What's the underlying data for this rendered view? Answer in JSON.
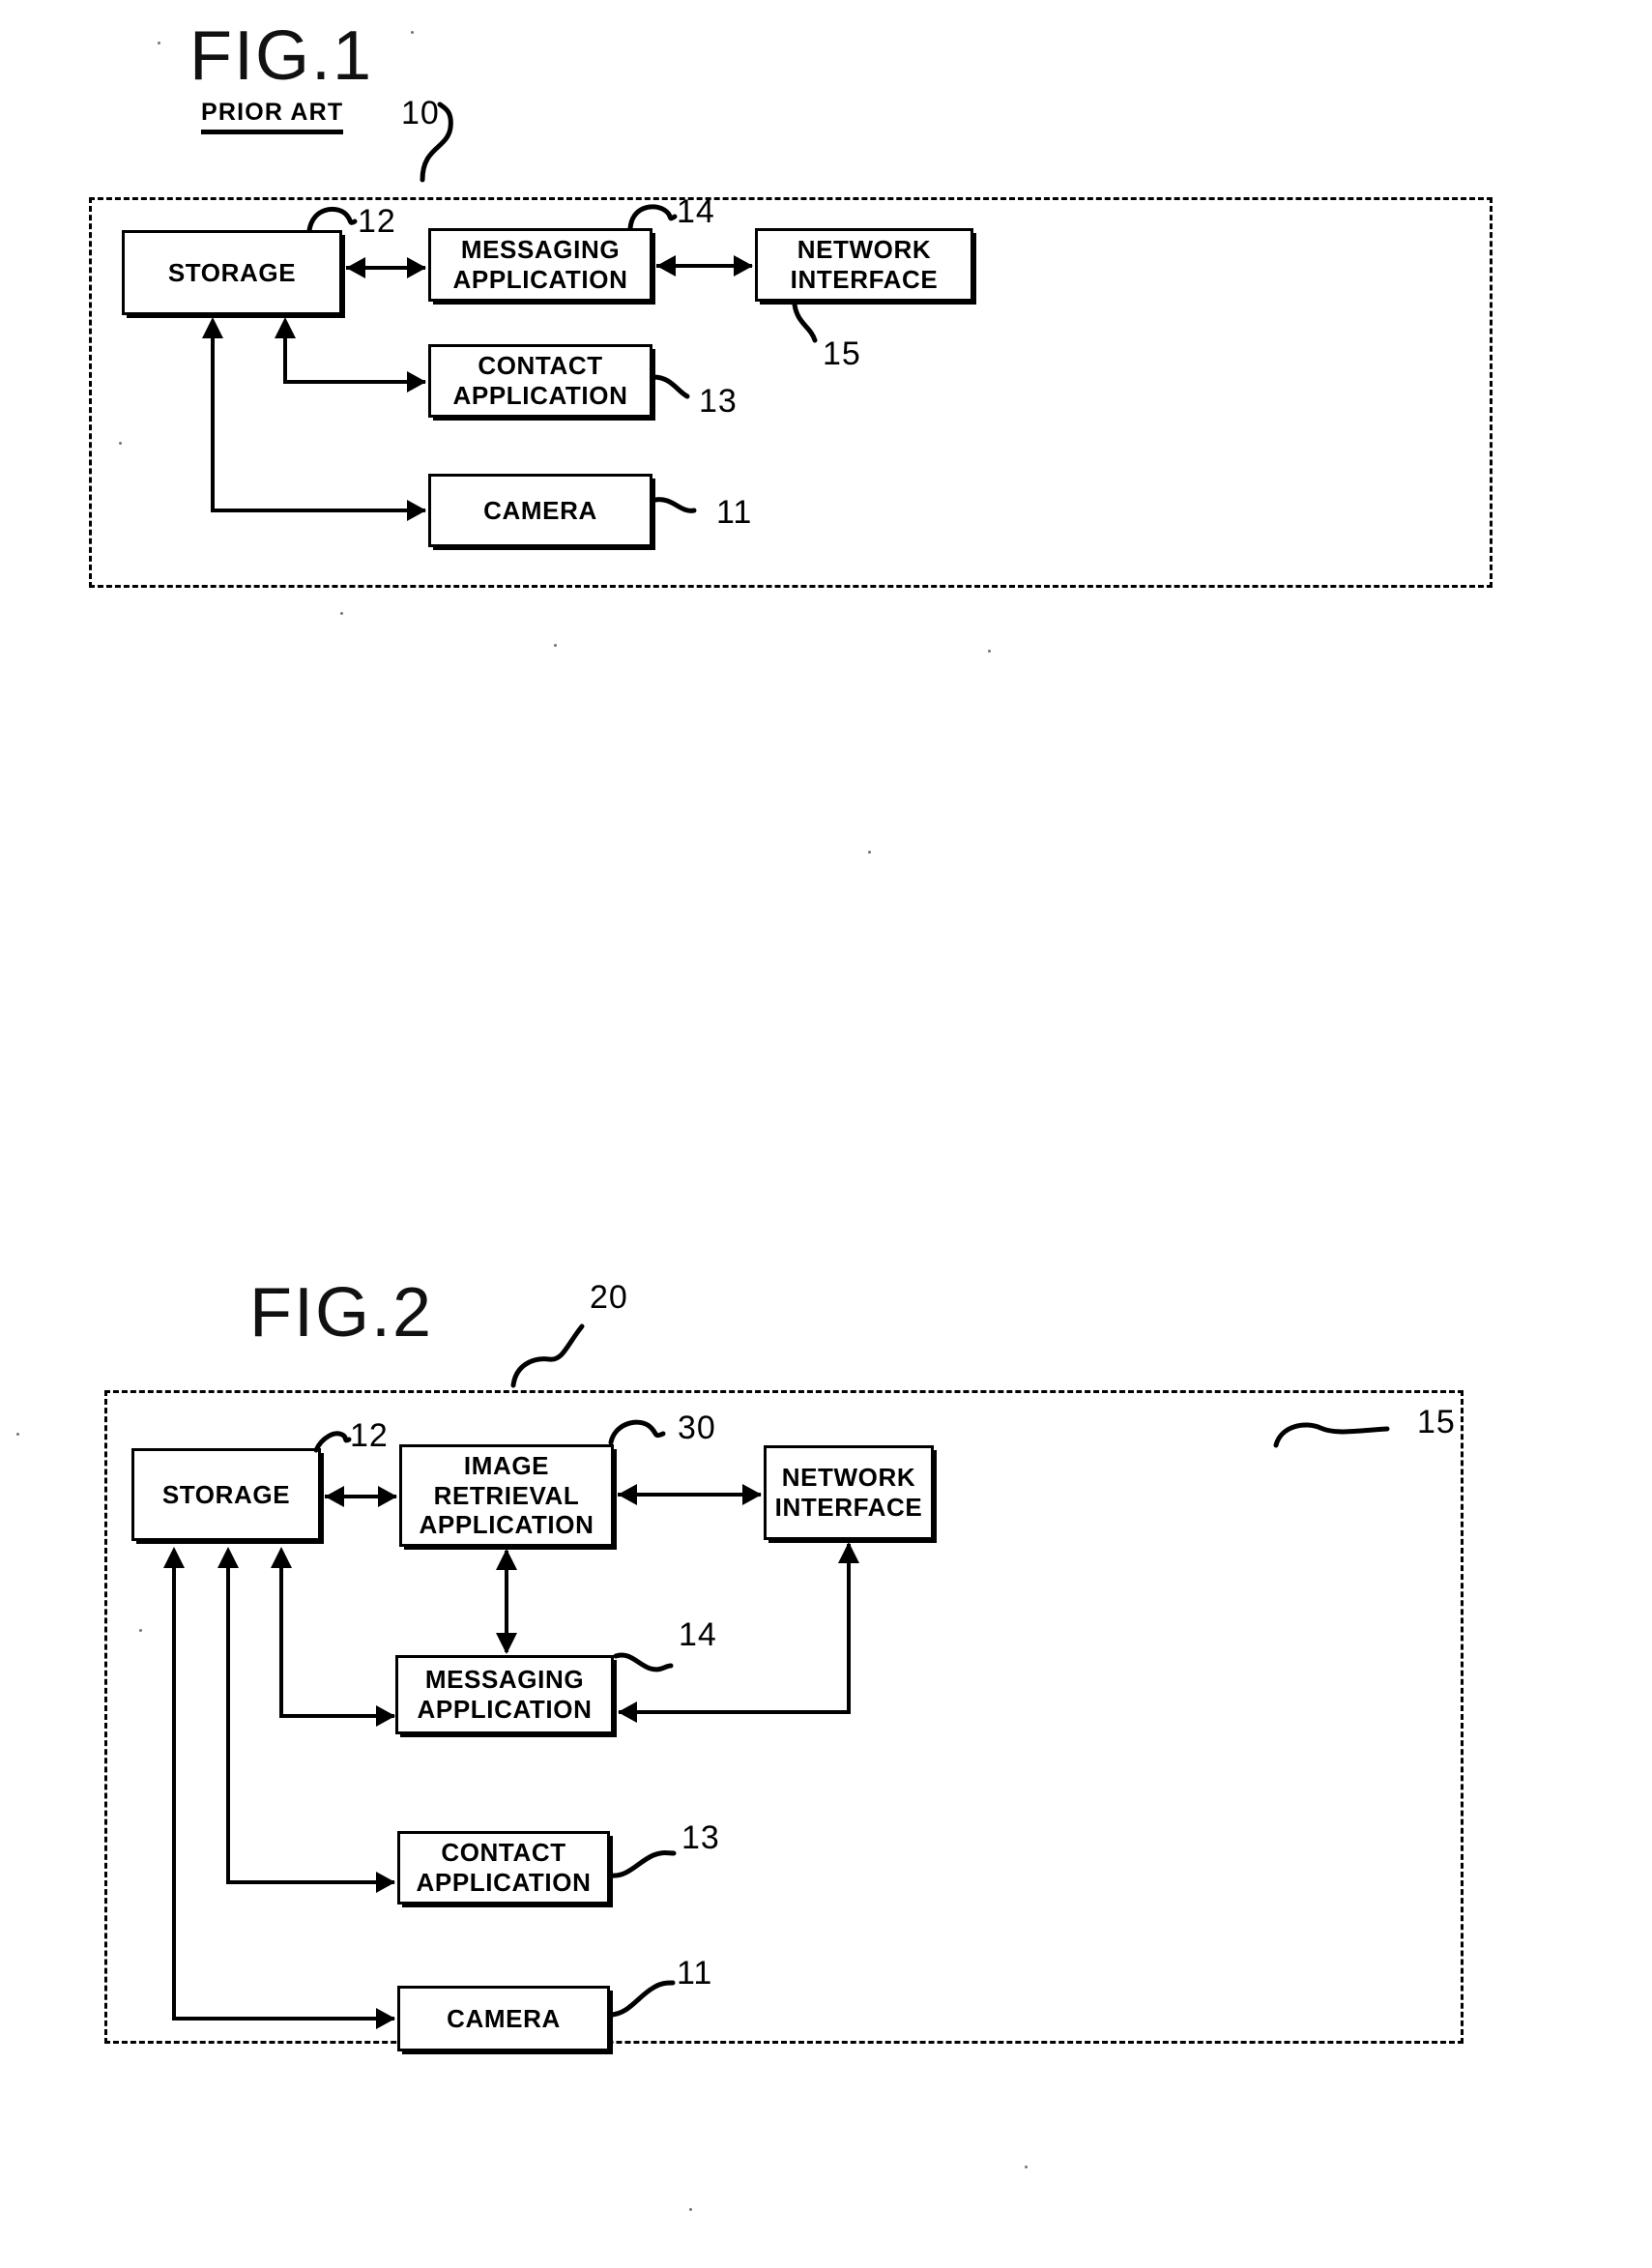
{
  "document": {
    "kind": "patent-figure-sheet",
    "figures": [
      {
        "id": "fig1",
        "title": "FIG.1",
        "subtitle": "PRIOR ART",
        "system_ref": "10",
        "blocks": [
          {
            "key": "storage",
            "label": "STORAGE",
            "ref": "12"
          },
          {
            "key": "messaging",
            "label": "MESSAGING\nAPPLICATION",
            "ref": "14"
          },
          {
            "key": "network",
            "label": "NETWORK\nINTERFACE",
            "ref": "15"
          },
          {
            "key": "contact",
            "label": "CONTACT\nAPPLICATION",
            "ref": "13"
          },
          {
            "key": "camera",
            "label": "CAMERA",
            "ref": "11"
          }
        ],
        "connections": [
          {
            "from": "storage",
            "to": "messaging",
            "type": "bidirectional"
          },
          {
            "from": "messaging",
            "to": "network",
            "type": "bidirectional"
          },
          {
            "from": "contact",
            "to": "storage",
            "type": "unidirectional"
          },
          {
            "from": "camera",
            "to": "storage",
            "type": "unidirectional"
          }
        ]
      },
      {
        "id": "fig2",
        "title": "FIG.2",
        "subtitle": "",
        "system_ref": "20",
        "blocks": [
          {
            "key": "storage",
            "label": "STORAGE",
            "ref": "12"
          },
          {
            "key": "retrieval",
            "label": "IMAGE\nRETRIEVAL\nAPPLICATION",
            "ref": "30"
          },
          {
            "key": "network",
            "label": "NETWORK\nINTERFACE",
            "ref": "15"
          },
          {
            "key": "messaging",
            "label": "MESSAGING\nAPPLICATION",
            "ref": "14"
          },
          {
            "key": "contact",
            "label": "CONTACT\nAPPLICATION",
            "ref": "13"
          },
          {
            "key": "camera",
            "label": "CAMERA",
            "ref": "11"
          }
        ],
        "connections": [
          {
            "from": "storage",
            "to": "retrieval",
            "type": "bidirectional"
          },
          {
            "from": "retrieval",
            "to": "network",
            "type": "bidirectional"
          },
          {
            "from": "retrieval",
            "to": "messaging",
            "type": "bidirectional"
          },
          {
            "from": "network",
            "to": "messaging",
            "type": "unidirectional"
          },
          {
            "from": "messaging",
            "to": "storage",
            "type": "unidirectional"
          },
          {
            "from": "contact",
            "to": "storage",
            "type": "unidirectional"
          },
          {
            "from": "camera",
            "to": "storage",
            "type": "unidirectional"
          }
        ]
      }
    ]
  },
  "fig1": {
    "title": "FIG.1",
    "prior_art": "PRIOR ART",
    "ref_system": "10",
    "storage_label": "STORAGE",
    "storage_ref": "12",
    "messaging_line1": "MESSAGING",
    "messaging_line2": "APPLICATION",
    "messaging_ref": "14",
    "network_line1": "NETWORK",
    "network_line2": "INTERFACE",
    "network_ref": "15",
    "contact_line1": "CONTACT",
    "contact_line2": "APPLICATION",
    "contact_ref": "13",
    "camera_label": "CAMERA",
    "camera_ref": "11"
  },
  "fig2": {
    "title": "FIG.2",
    "ref_system": "20",
    "storage_label": "STORAGE",
    "storage_ref": "12",
    "retrieval_line1": "IMAGE",
    "retrieval_line2": "RETRIEVAL",
    "retrieval_line3": "APPLICATION",
    "retrieval_ref": "30",
    "network_line1": "NETWORK",
    "network_line2": "INTERFACE",
    "network_ref": "15",
    "messaging_line1": "MESSAGING",
    "messaging_line2": "APPLICATION",
    "messaging_ref": "14",
    "contact_line1": "CONTACT",
    "contact_line2": "APPLICATION",
    "contact_ref": "13",
    "camera_label": "CAMERA",
    "camera_ref": "11"
  },
  "colors": {
    "ink": "#000000",
    "paper": "#ffffff"
  }
}
